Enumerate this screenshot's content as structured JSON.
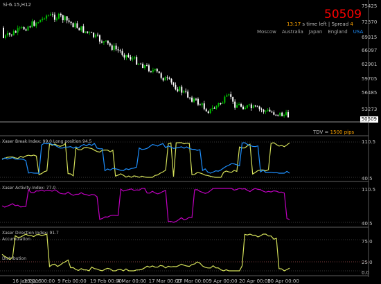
{
  "chart": {
    "symbol_tf": "Si-6.15,H12",
    "price_display": "50509",
    "time_left": "13:17",
    "time_left_suffix": "s time left",
    "spread_label": "Spread",
    "spread_value": "4",
    "sessions": [
      {
        "name": "Moscow",
        "color": "#a0a0a0"
      },
      {
        "name": "Australia",
        "color": "#a0a0a0"
      },
      {
        "name": "Japan",
        "color": "#a0a0a0"
      },
      {
        "name": "England",
        "color": "#a0a0a0"
      },
      {
        "name": "USA",
        "color": "#1e90ff"
      }
    ],
    "price_axis": [
      "75425",
      "72370",
      "69315",
      "66097",
      "62901",
      "59705",
      "56485",
      "53273"
    ],
    "current_price_tag": "50509",
    "tdv_label": "TDV =",
    "tdv_value": "1500 pips"
  },
  "panels": {
    "break": {
      "title": "Xaser Break Index: 99.0 Long position",
      "title2": "94.5",
      "axis_top": "110.5",
      "axis_bottom": "40.5"
    },
    "activity": {
      "title": "Xaser Activity Index: 77.0",
      "axis_top": "110.5",
      "axis_bottom": "40.5"
    },
    "direction": {
      "title": "Xaser Direction Index: 91.7",
      "subtitle": "Accumulation",
      "subtitle2": "Distribution",
      "axis_75": "75.0",
      "axis_25": "25.0",
      "axis_bottom": "0.0"
    }
  },
  "dates": [
    "16 Jan 2015",
    "29 Jan 00:00",
    "9 Feb 00:00",
    "19 Feb 00:00",
    "4 Mar 00:00",
    "17 Mar 00:00",
    "27 Mar 00:00",
    "9 Apr 00:00",
    "20 Apr 00:00",
    "30 Apr 00:00"
  ],
  "colors": {
    "bull": "#00c000",
    "bear": "#ffffff",
    "price_big": "#ff0000",
    "time_orange": "#ffa500",
    "break_blue": "#1e90ff",
    "break_yellow": "#d4e05a",
    "activity_magenta": "#c000c0",
    "direction_yellow": "#d4e05a",
    "tdv_orange": "#ffa500"
  }
}
